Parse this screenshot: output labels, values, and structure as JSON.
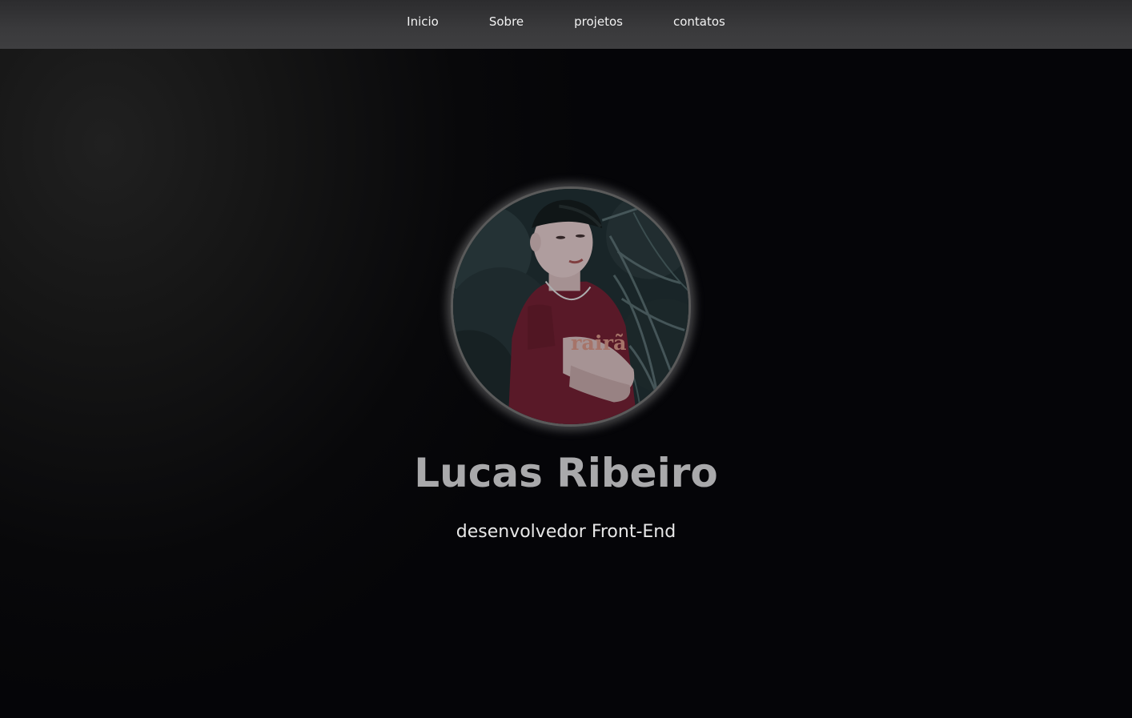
{
  "nav": {
    "items": [
      {
        "label": "Inicio"
      },
      {
        "label": "Sobre"
      },
      {
        "label": "projetos"
      },
      {
        "label": "contatos"
      }
    ]
  },
  "profile": {
    "name": "Lucas Ribeiro",
    "role": "desenvolvedor Front-End",
    "photo_icon": "profile-photo"
  },
  "colors": {
    "nav_background": "#3a3a3c",
    "page_background": "#050508",
    "name_text": "#a9a9ab",
    "role_text": "#e8e8e8",
    "shirt": "#6b1c2c"
  }
}
